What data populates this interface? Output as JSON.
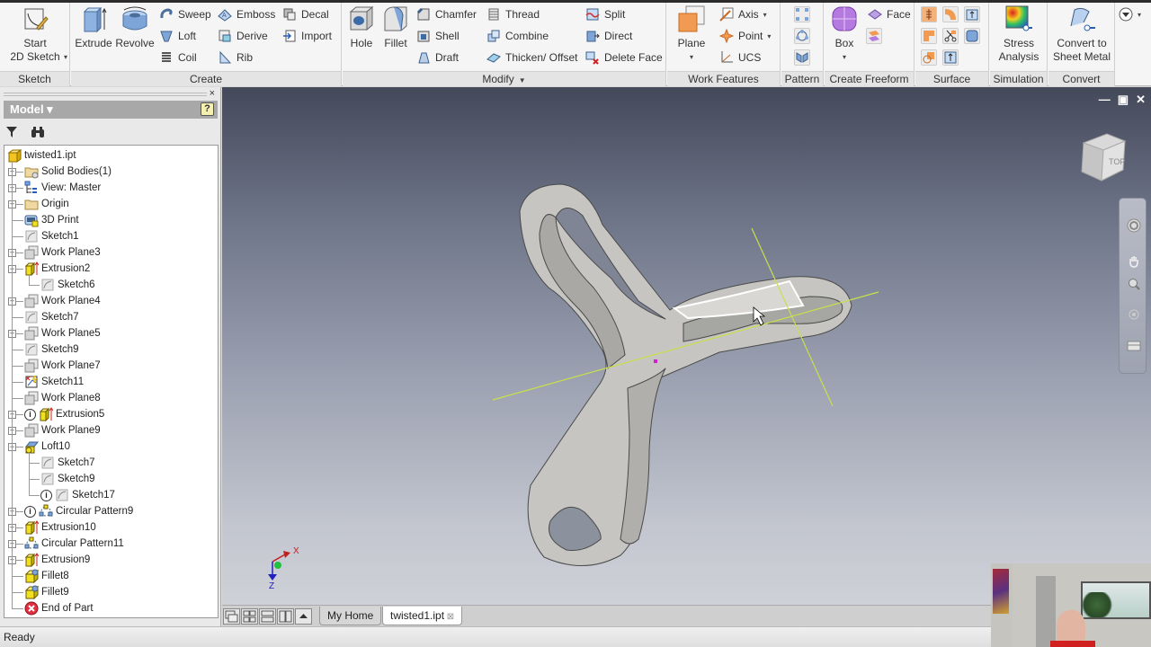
{
  "ribbon": {
    "panels": {
      "sketch": {
        "title": "Sketch",
        "start_sketch": "Start\n2D Sketch"
      },
      "create": {
        "title": "Create",
        "extrude": "Extrude",
        "revolve": "Revolve",
        "sweep": "Sweep",
        "loft": "Loft",
        "coil": "Coil",
        "emboss": "Emboss",
        "derive": "Derive",
        "rib": "Rib",
        "decal": "Decal",
        "import": "Import"
      },
      "modify": {
        "title": "Modify",
        "hole": "Hole",
        "fillet": "Fillet",
        "chamfer": "Chamfer",
        "shell": "Shell",
        "draft": "Draft",
        "thread": "Thread",
        "combine": "Combine",
        "thicken": "Thicken/ Offset",
        "split": "Split",
        "direct": "Direct",
        "delete_face": "Delete Face"
      },
      "work_features": {
        "title": "Work Features",
        "plane": "Plane",
        "axis": "Axis",
        "point": "Point",
        "ucs": "UCS"
      },
      "pattern": {
        "title": "Pattern"
      },
      "freeform": {
        "title": "Create Freeform",
        "box": "Box",
        "face": "Face"
      },
      "surface": {
        "title": "Surface"
      },
      "simulation": {
        "title": "Simulation",
        "stress": "Stress Analysis"
      },
      "convert": {
        "title": "Convert",
        "sheet_metal": "Convert to Sheet Metal"
      }
    }
  },
  "browser": {
    "header": "Model ▾",
    "help": "?",
    "close": "×",
    "tree": [
      {
        "label": "twisted1.ipt",
        "icon": "part-icon",
        "level": 0,
        "expander": ""
      },
      {
        "label": "Solid Bodies(1)",
        "icon": "solid-bodies-folder-icon",
        "level": 1,
        "expander": "+"
      },
      {
        "label": "View: Master",
        "icon": "view-rep-icon",
        "level": 1,
        "expander": "+"
      },
      {
        "label": "Origin",
        "icon": "folder-icon",
        "level": 1,
        "expander": "+"
      },
      {
        "label": "3D Print",
        "icon": "3d-print-icon",
        "level": 1,
        "expander": ""
      },
      {
        "label": "Sketch1",
        "icon": "sketch-icon",
        "level": 1,
        "expander": ""
      },
      {
        "label": "Work Plane3",
        "icon": "work-plane-icon",
        "level": 1,
        "expander": "+"
      },
      {
        "label": "Extrusion2",
        "icon": "extrusion-icon",
        "level": 1,
        "expander": "-"
      },
      {
        "label": "Sketch6",
        "icon": "sketch-icon",
        "level": 2,
        "expander": ""
      },
      {
        "label": "Work Plane4",
        "icon": "work-plane-icon",
        "level": 1,
        "expander": "+"
      },
      {
        "label": "Sketch7",
        "icon": "sketch-icon",
        "level": 1,
        "expander": ""
      },
      {
        "label": "Work Plane5",
        "icon": "work-plane-icon",
        "level": 1,
        "expander": "+"
      },
      {
        "label": "Sketch9",
        "icon": "sketch-icon",
        "level": 1,
        "expander": ""
      },
      {
        "label": "Work Plane7",
        "icon": "work-plane-icon",
        "level": 1,
        "expander": ""
      },
      {
        "label": "Sketch11",
        "icon": "sketch-error-icon",
        "level": 1,
        "expander": ""
      },
      {
        "label": "Work Plane8",
        "icon": "work-plane-icon",
        "level": 1,
        "expander": ""
      },
      {
        "label": "Extrusion5",
        "icon": "extrusion-icon",
        "level": 1,
        "expander": "+",
        "status": "i"
      },
      {
        "label": "Work Plane9",
        "icon": "work-plane-icon",
        "level": 1,
        "expander": "+"
      },
      {
        "label": "Loft10",
        "icon": "loft-icon",
        "level": 1,
        "expander": "-"
      },
      {
        "label": "Sketch7",
        "icon": "sketch-icon",
        "level": 2,
        "expander": ""
      },
      {
        "label": "Sketch9",
        "icon": "sketch-icon",
        "level": 2,
        "expander": ""
      },
      {
        "label": "Sketch17",
        "icon": "sketch-icon",
        "level": 2,
        "expander": "",
        "status": "i"
      },
      {
        "label": "Circular Pattern9",
        "icon": "circular-pattern-icon",
        "level": 1,
        "expander": "+",
        "status": "i"
      },
      {
        "label": "Extrusion10",
        "icon": "extrusion-icon",
        "level": 1,
        "expander": "+"
      },
      {
        "label": "Circular Pattern11",
        "icon": "circular-pattern-icon",
        "level": 1,
        "expander": "+"
      },
      {
        "label": "Extrusion9",
        "icon": "extrusion-icon",
        "level": 1,
        "expander": "+"
      },
      {
        "label": "Fillet8",
        "icon": "fillet-icon",
        "level": 1,
        "expander": ""
      },
      {
        "label": "Fillet9",
        "icon": "fillet-icon",
        "level": 1,
        "expander": ""
      },
      {
        "label": "End of Part",
        "icon": "end-of-part-icon",
        "level": 1,
        "expander": ""
      }
    ]
  },
  "viewport": {
    "viewcube_label": "TOP",
    "triad": {
      "x": "X",
      "z": "Z"
    },
    "window_controls": {
      "minimize": "—",
      "restore": "▣",
      "close": "✕"
    }
  },
  "doc_tabs": [
    {
      "label": "My Home",
      "active": false
    },
    {
      "label": "twisted1.ipt",
      "active": true
    }
  ],
  "status_bar": {
    "text": "Ready"
  },
  "colors": {
    "accent_axis": "#c8e04a",
    "selection": "#ffffff",
    "part_body": "#c4c3c0"
  }
}
